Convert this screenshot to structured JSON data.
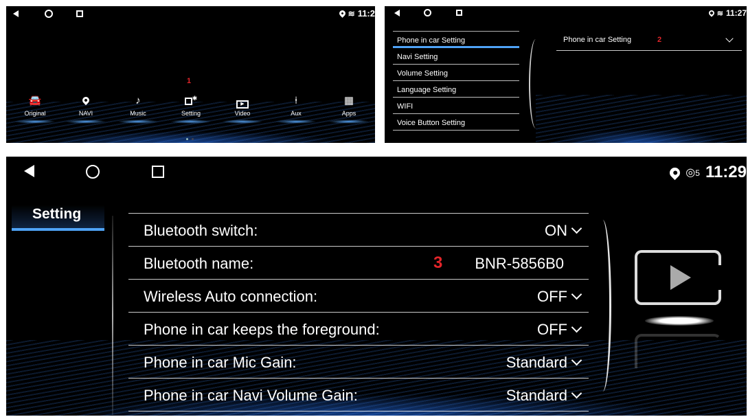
{
  "panel1": {
    "status": {
      "time": "11:2"
    },
    "step_marker": "1",
    "apps": [
      {
        "label": "Original",
        "icon": "car-icon"
      },
      {
        "label": "NAVI",
        "icon": "location-pin-icon"
      },
      {
        "label": "Music",
        "icon": "music-note-icon"
      },
      {
        "label": "Setting",
        "icon": "settings-icon"
      },
      {
        "label": "Video",
        "icon": "video-play-icon"
      },
      {
        "label": "Aux",
        "icon": "aux-plug-icon"
      },
      {
        "label": "Apps",
        "icon": "apps-grid-icon"
      }
    ],
    "page_dots": 2
  },
  "panel2": {
    "status": {
      "time": "11:27"
    },
    "menu": [
      "Phone in car Setting",
      "Navi Setting",
      "Volume Setting",
      "Language Setting",
      "WIFI",
      "Voice Button Setting"
    ],
    "selected_title": "Phone in car Setting",
    "step_marker": "2"
  },
  "panel3": {
    "status": {
      "time": "11:29",
      "wifi_badge": "5"
    },
    "side_tab": "Setting",
    "step_marker": "3",
    "rows": [
      {
        "label": "Bluetooth switch:",
        "value": "ON"
      },
      {
        "label": "Bluetooth name:",
        "value": "BNR-5856B0"
      },
      {
        "label": "Wireless Auto connection:",
        "value": "OFF"
      },
      {
        "label": "Phone in car keeps the foreground:",
        "value": "OFF"
      },
      {
        "label": "Phone in car Mic Gain:",
        "value": "Standard"
      },
      {
        "label": "Phone in car Navi Volume Gain:",
        "value": "Standard"
      }
    ],
    "accent_color": "#4fa3f7"
  }
}
